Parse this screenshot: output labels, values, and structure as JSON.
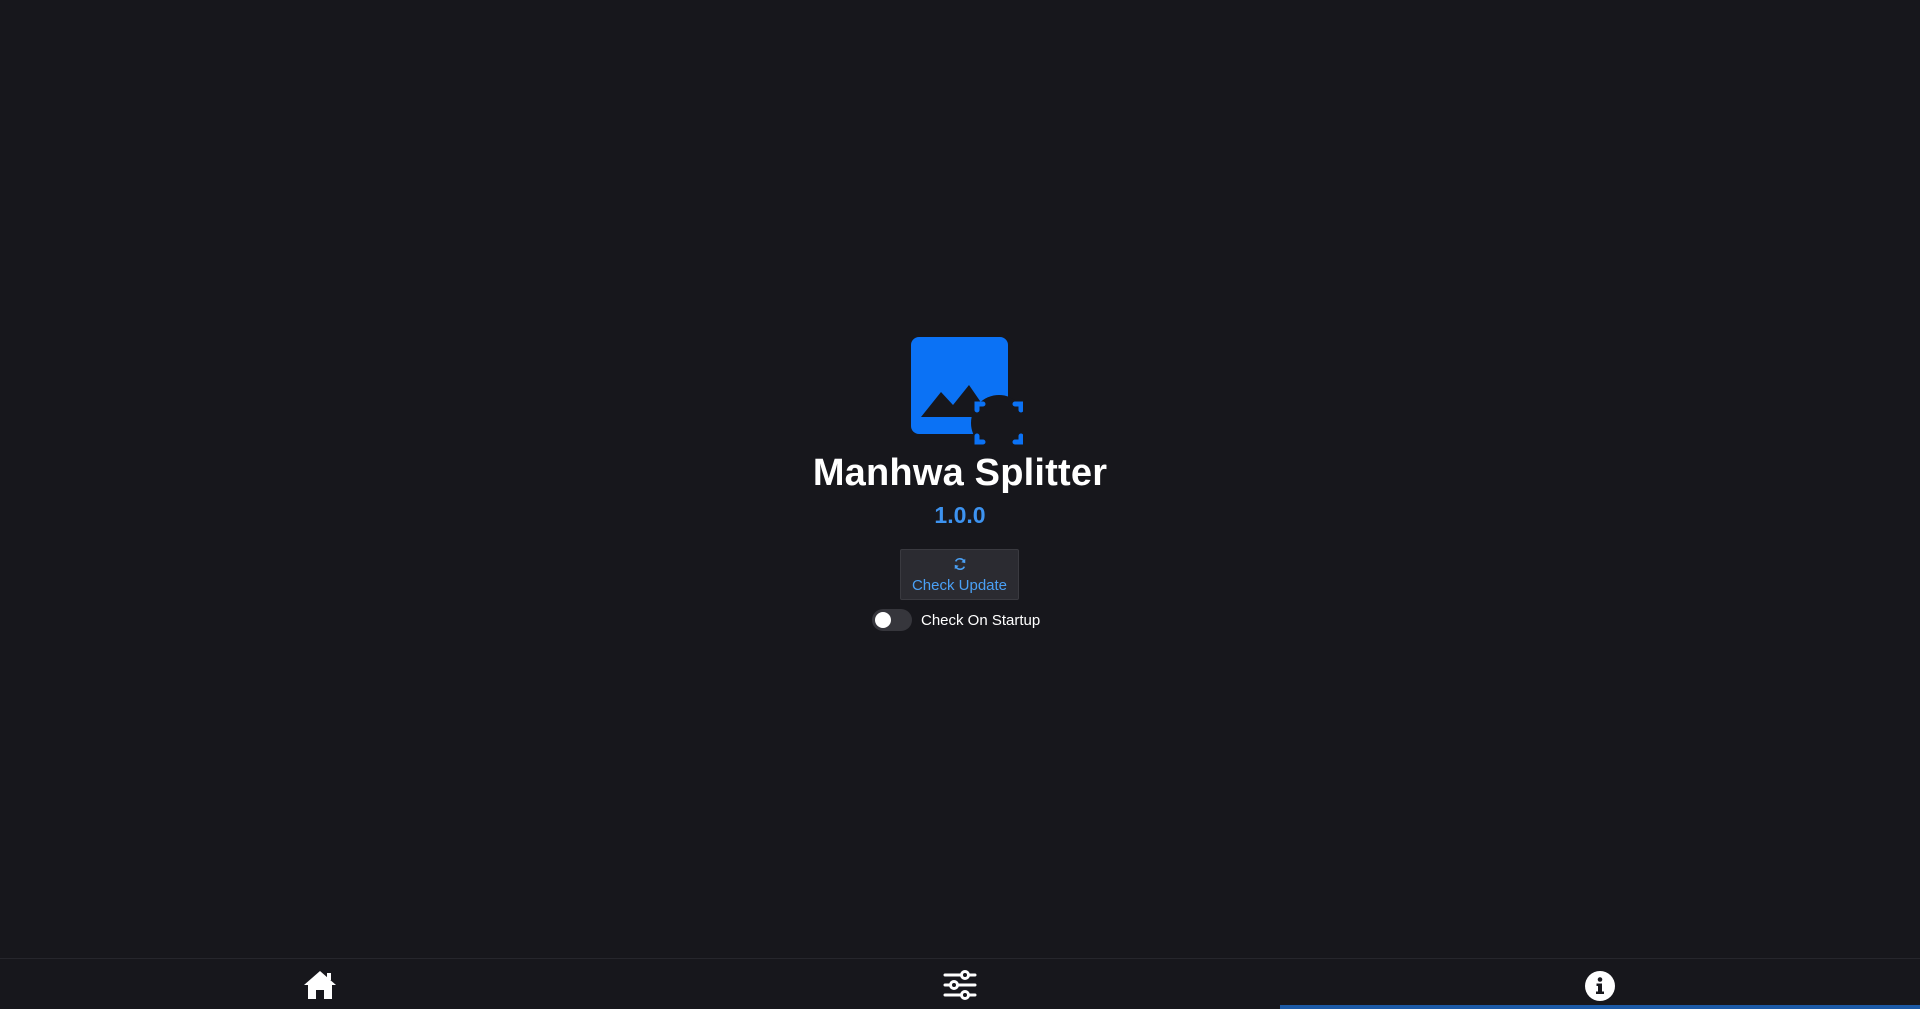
{
  "app": {
    "name": "Manhwa Splitter",
    "version": "1.0.0",
    "accent_color": "#0b72f5"
  },
  "update": {
    "button_label": "Check Update",
    "icon": "refresh-icon"
  },
  "startup_toggle": {
    "label": "Check On Startup",
    "enabled": false
  },
  "nav": {
    "items": [
      {
        "id": "home",
        "icon": "home-icon",
        "active": false
      },
      {
        "id": "settings",
        "icon": "sliders-icon",
        "active": false
      },
      {
        "id": "about",
        "icon": "info-icon",
        "active": true
      }
    ],
    "active_indicator_color": "#1c5aa6"
  }
}
